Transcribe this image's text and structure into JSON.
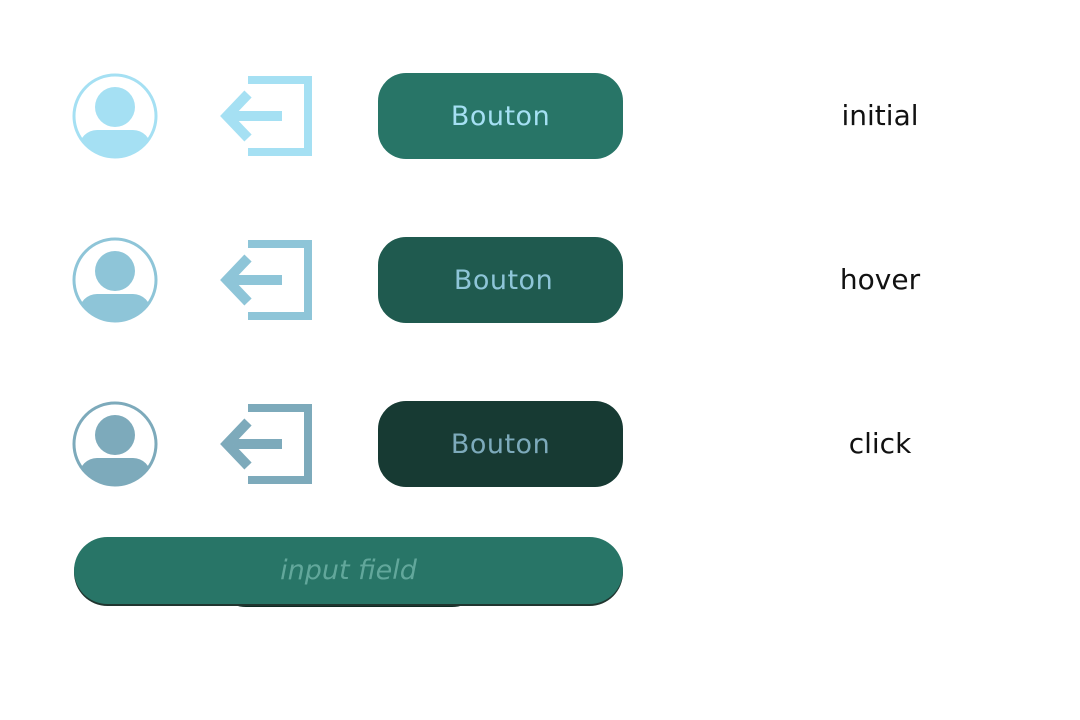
{
  "colors": {
    "initial_icon": "#a5e0f3",
    "hover_icon": "#8ec5d8",
    "click_icon": "#7daabb",
    "initial_button_bg": "#287567",
    "hover_button_bg": "#1f5a4f",
    "click_button_bg": "#173a33",
    "initial_button_text": "#a5e0f3",
    "hover_button_text": "#8ec5d8",
    "click_button_text": "#7daabb",
    "input_bg": "#287567",
    "input_placeholder": "#62a79b"
  },
  "rows": [
    {
      "state": "initial",
      "button_label": "Bouton",
      "avatar_icon": "user-avatar-icon",
      "logout_icon": "logout-arrow-icon"
    },
    {
      "state": "hover",
      "button_label": "Bouton",
      "avatar_icon": "user-avatar-icon",
      "logout_icon": "logout-arrow-icon"
    },
    {
      "state": "click",
      "button_label": "Bouton",
      "avatar_icon": "user-avatar-icon",
      "logout_icon": "logout-arrow-icon"
    }
  ],
  "input": {
    "placeholder": "input field",
    "value": ""
  }
}
